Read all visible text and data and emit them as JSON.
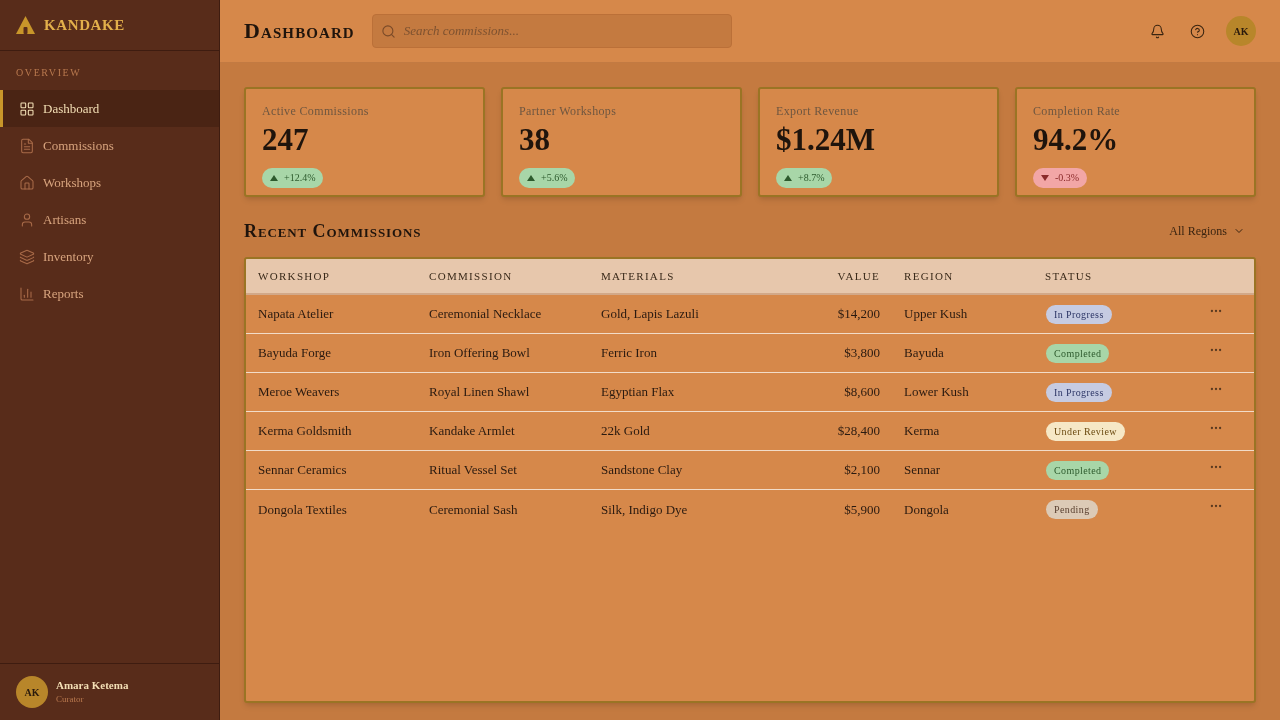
{
  "sidebar": {
    "brand": "KANDAKE",
    "section_label": "OVERVIEW",
    "nav": [
      {
        "label": "Dashboard",
        "selected": true
      },
      {
        "label": "Commissions",
        "selected": false
      },
      {
        "label": "Workshops",
        "selected": false
      },
      {
        "label": "Artisans",
        "selected": false
      },
      {
        "label": "Inventory",
        "selected": false
      },
      {
        "label": "Reports",
        "selected": false
      }
    ],
    "user": {
      "initials": "AK",
      "name": "Amara Ketema",
      "role": "Curator"
    }
  },
  "header": {
    "title": "Dashboard",
    "search": {
      "placeholder": "Search commissions..."
    },
    "avatar_initials": "AK"
  },
  "stats": [
    {
      "label": "Active Commissions",
      "value": "247",
      "change": {
        "kind": "up",
        "text": "+12.4%"
      }
    },
    {
      "label": "Partner Workshops",
      "value": "38",
      "change": {
        "kind": "up",
        "text": "+5.6%"
      }
    },
    {
      "label": "Export Revenue",
      "value": "$1.24M",
      "change": {
        "kind": "up",
        "text": "+8.7%"
      }
    },
    {
      "label": "Completion Rate",
      "value": "94.2%",
      "change": {
        "kind": "down",
        "text": "-0.3%"
      }
    }
  ],
  "recent_commissions": {
    "title": "Recent Commissions",
    "filter": "All Regions",
    "table": {
      "columns": [
        "WORKSHOP",
        "COMMISSION",
        "MATERIALS",
        "VALUE",
        "REGION",
        "STATUS"
      ],
      "rows": [
        {
          "workshop": "Napata Atelier",
          "commission": "Ceremonial Necklace",
          "materials": "Gold, Lapis Lazuli",
          "value": "$14,200",
          "region": "Upper Kush",
          "status": {
            "kind": "in_progress",
            "text": "In Progress"
          }
        },
        {
          "workshop": "Bayuda Forge",
          "commission": "Iron Offering Bowl",
          "materials": "Ferric Iron",
          "value": "$3,800",
          "region": "Bayuda",
          "status": {
            "kind": "completed",
            "text": "Completed"
          }
        },
        {
          "workshop": "Meroe Weavers",
          "commission": "Royal Linen Shawl",
          "materials": "Egyptian Flax",
          "value": "$8,600",
          "region": "Lower Kush",
          "status": {
            "kind": "in_progress",
            "text": "In Progress"
          }
        },
        {
          "workshop": "Kerma Goldsmith",
          "commission": "Kandake Armlet",
          "materials": "22k Gold",
          "value": "$28,400",
          "region": "Kerma",
          "status": {
            "kind": "under_review",
            "text": "Under Review"
          }
        },
        {
          "workshop": "Sennar Ceramics",
          "commission": "Ritual Vessel Set",
          "materials": "Sandstone Clay",
          "value": "$2,100",
          "region": "Sennar",
          "status": {
            "kind": "completed",
            "text": "Completed"
          }
        },
        {
          "workshop": "Dongola Textiles",
          "commission": "Ceremonial Sash",
          "materials": "Silk, Indigo Dye",
          "value": "$5,900",
          "region": "Dongola",
          "status": {
            "kind": "pending",
            "text": "Pending"
          }
        }
      ]
    }
  }
}
